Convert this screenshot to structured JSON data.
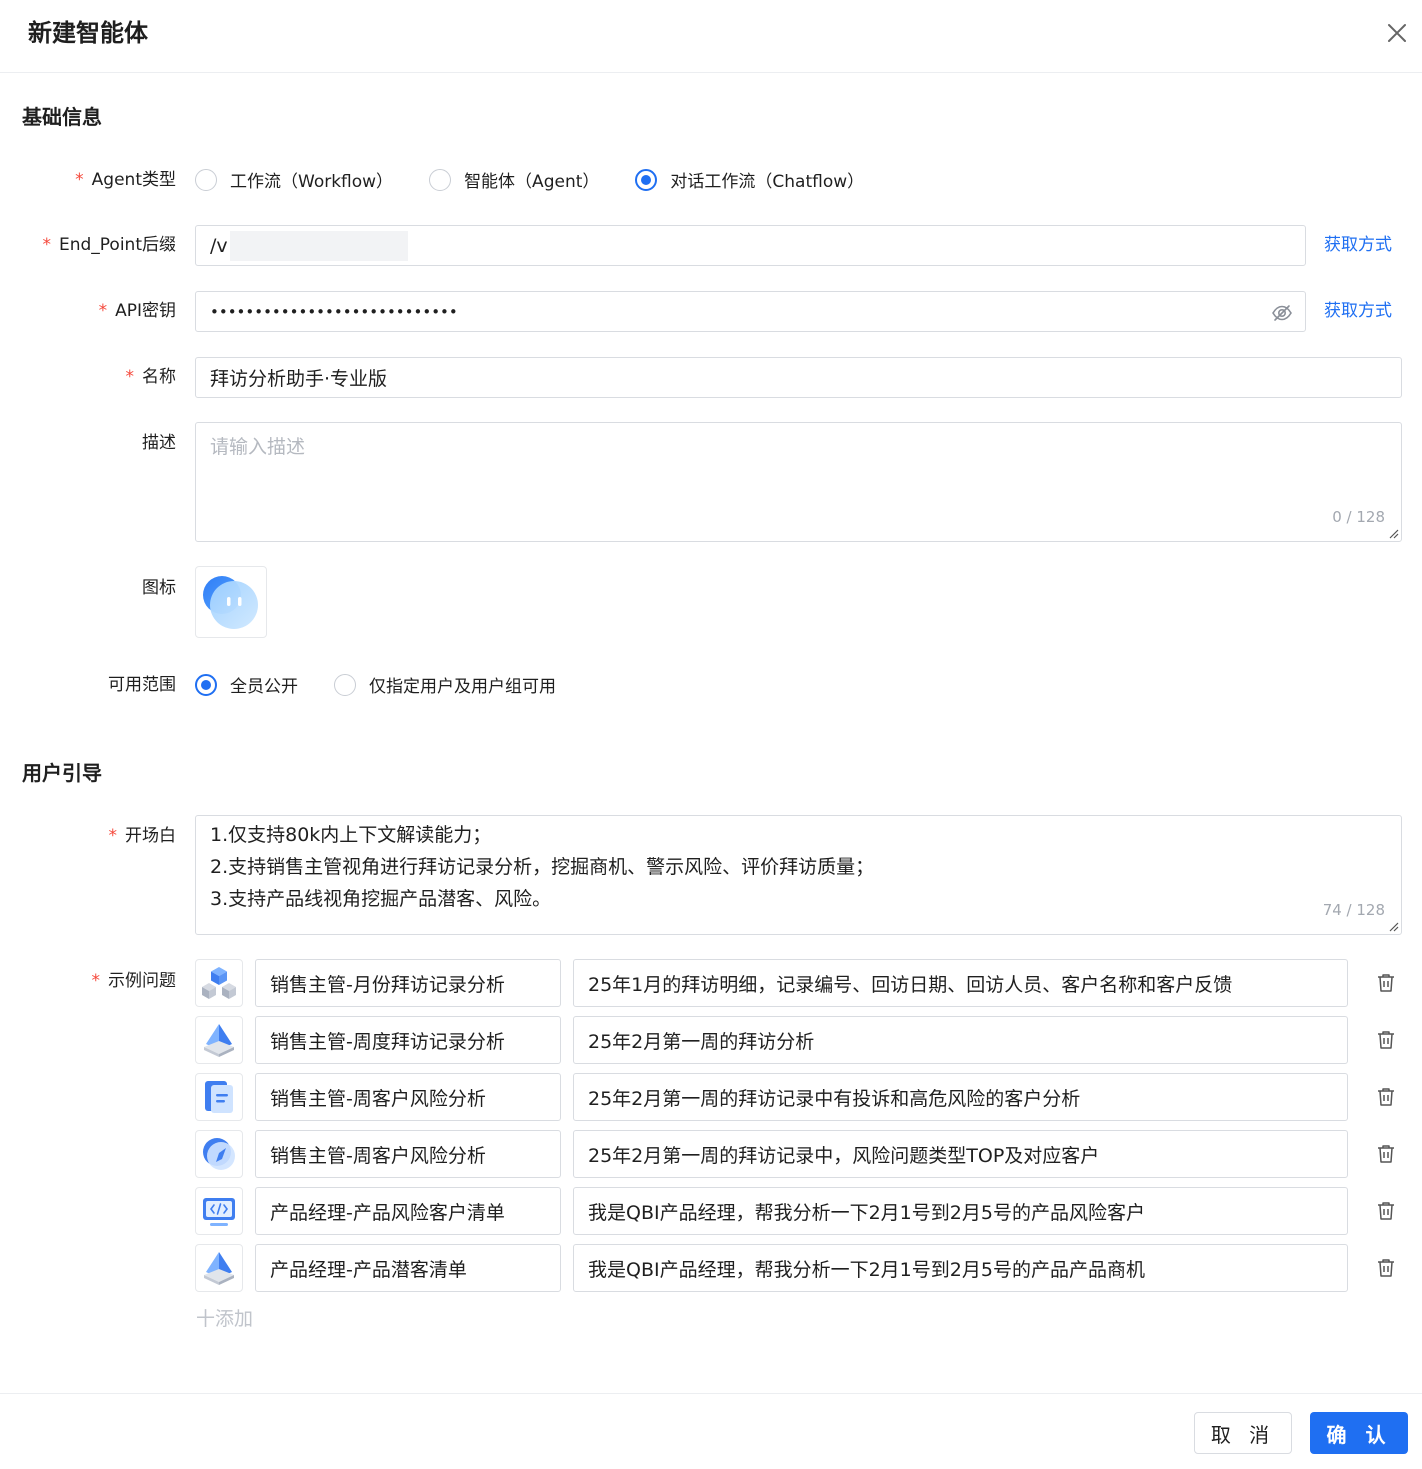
{
  "dialog": {
    "title": "新建智能体"
  },
  "basic": {
    "section_title": "基础信息",
    "agent_type": {
      "label": "Agent类型",
      "options": [
        "工作流（Workflow）",
        "智能体（Agent）",
        "对话工作流（Chatflow）"
      ],
      "selected": "对话工作流（Chatflow）"
    },
    "endpoint": {
      "label": "End_Point后缀",
      "value": "/v",
      "link": "获取方式"
    },
    "api_key": {
      "label": "API密钥",
      "value": "••••••••••••••••••••••••••••",
      "link": "获取方式"
    },
    "name": {
      "label": "名称",
      "value": "拜访分析助手·专业版"
    },
    "description": {
      "label": "描述",
      "placeholder": "请输入描述",
      "counter": "0 / 128"
    },
    "icon": {
      "label": "图标",
      "icon_name": "chat-bubble-icon"
    },
    "scope": {
      "label": "可用范围",
      "options": [
        "全员公开",
        "仅指定用户及用户组可用"
      ],
      "selected": "全员公开"
    }
  },
  "guide": {
    "section_title": "用户引导",
    "opening": {
      "label": "开场白",
      "lines": [
        "1.仅支持80k内上下文解读能力；",
        "2.支持销售主管视角进行拜访记录分析，挖掘商机、警示风险、评价拜访质量；",
        "3.支持产品线视角挖掘产品潜客、风险。"
      ],
      "counter": "74 / 128"
    },
    "examples": {
      "label": "示例问题",
      "items": [
        {
          "icon": "cubes-icon",
          "title": "销售主管-月份拜访记录分析",
          "question": "25年1月的拜访明细，记录编号、回访日期、回访人员、客户名称和客户反馈"
        },
        {
          "icon": "pyramid-icon",
          "title": "销售主管-周度拜访记录分析",
          "question": "25年2月第一周的拜访分析"
        },
        {
          "icon": "document-icon",
          "title": "销售主管-周客户风险分析",
          "question": "25年2月第一周的拜访记录中有投诉和高危风险的客户分析"
        },
        {
          "icon": "compass-icon",
          "title": "销售主管-周客户风险分析",
          "question": "25年2月第一周的拜访记录中，风险问题类型TOP及对应客户"
        },
        {
          "icon": "code-monitor-icon",
          "title": "产品经理-产品风险客户清单",
          "question": "我是QBI产品经理，帮我分析一下2月1号到2月5号的产品风险客户"
        },
        {
          "icon": "pyramid-icon",
          "title": "产品经理-产品潜客清单",
          "question": "我是QBI产品经理，帮我分析一下2月1号到2月5号的产品产品商机"
        }
      ],
      "add_label": "十添加"
    }
  },
  "footer": {
    "cancel": "取 消",
    "confirm": "确 认"
  },
  "colors": {
    "primary": "#1f6ff2",
    "required": "#f5483b",
    "border": "#d9dce1"
  }
}
